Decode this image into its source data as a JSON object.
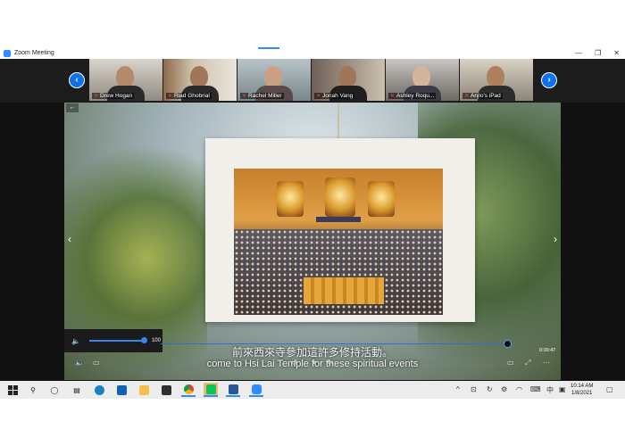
{
  "window": {
    "title": "Zoom Meeting",
    "controls": {
      "minimize": "—",
      "restore": "❐",
      "close": "✕"
    }
  },
  "gallery": {
    "prev_icon": "‹",
    "next_icon": "›",
    "participants": [
      {
        "name": "Drew Hogan"
      },
      {
        "name": "Riad Ghobrial"
      },
      {
        "name": "Rachel Miller"
      },
      {
        "name": "Jonah Vang"
      },
      {
        "name": "Ashley Roqu..."
      },
      {
        "name": "Anjlo's iPad"
      }
    ]
  },
  "video": {
    "back_icon": "←",
    "subtitle_zh": "前來西來寺參加這許多修持活動。",
    "subtitle_en": "come to Hsi Lai Temple for these spiritual events",
    "volume": 100,
    "volume_label": "100",
    "progress": 0.99,
    "time": "0:00:47"
  },
  "taskbar": {
    "time": "10:14 AM",
    "date": "1/8/2021",
    "ime": "中",
    "accent": "#2D8CFF"
  },
  "colors": {
    "zoom_blue": "#2D8CFF",
    "nav_blue": "#0E72ED",
    "mic_muted": "#ff4545"
  }
}
